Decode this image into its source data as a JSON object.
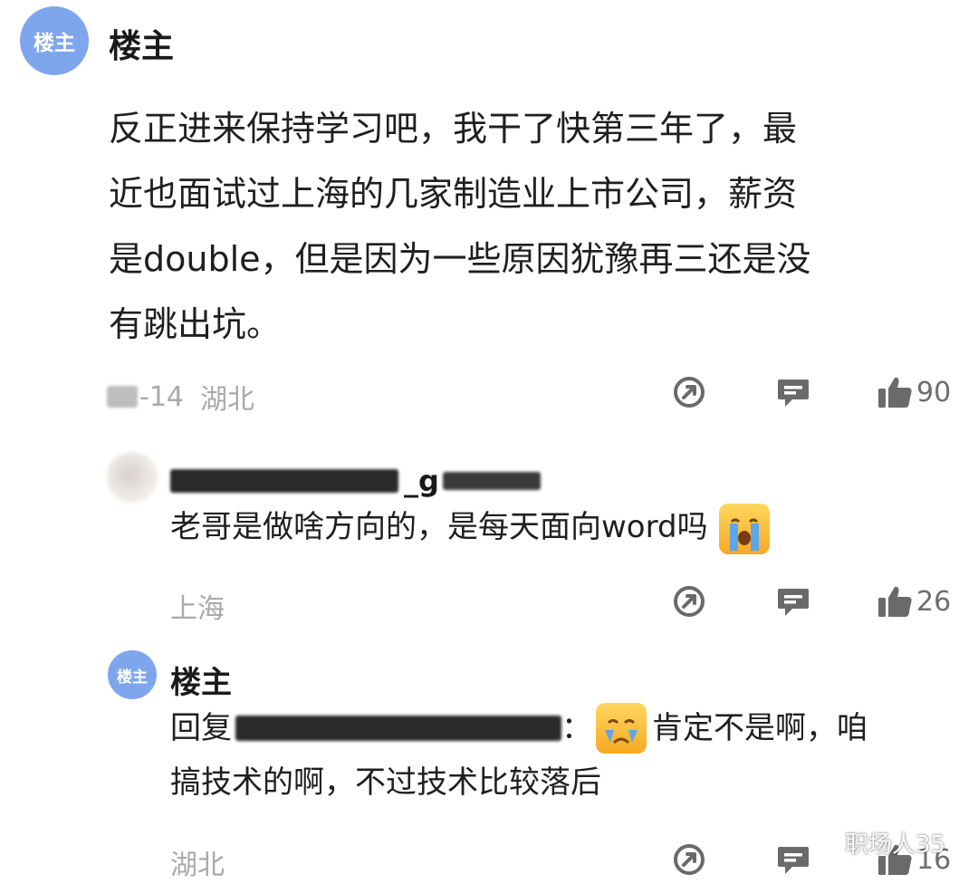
{
  "post": {
    "avatar_text": "楼主",
    "author": "楼主",
    "lines": [
      "反正进来保持学习吧，我干了快第三年了，最",
      "近也面试过上海的几家制造业上市公司，薪资",
      "是double，但是因为一些原因犹豫再三还是没",
      "有跳出坑。"
    ],
    "date": "-14",
    "location": "湖北",
    "likes": "90"
  },
  "comment1": {
    "username_tail": "_g",
    "text": "老哥是做啥方向的，是每天面向word吗",
    "emoji": "loudly-crying-face",
    "location": "上海",
    "likes": "26"
  },
  "comment2": {
    "avatar_text": "楼主",
    "author": "楼主",
    "reply_prefix": "回复",
    "reply_colon": "：",
    "emoji": "crying-face",
    "text_part1": "肯定不是啊，咱",
    "text_line2": "搞技术的啊，不过技术比较落后",
    "location": "湖北",
    "likes": "16"
  },
  "watermark": {
    "text": "职场人35"
  },
  "colors": {
    "avatar": "#7ea6ec",
    "meta_gray": "#a9a9a9",
    "icon_gray": "#6a6a6a"
  }
}
